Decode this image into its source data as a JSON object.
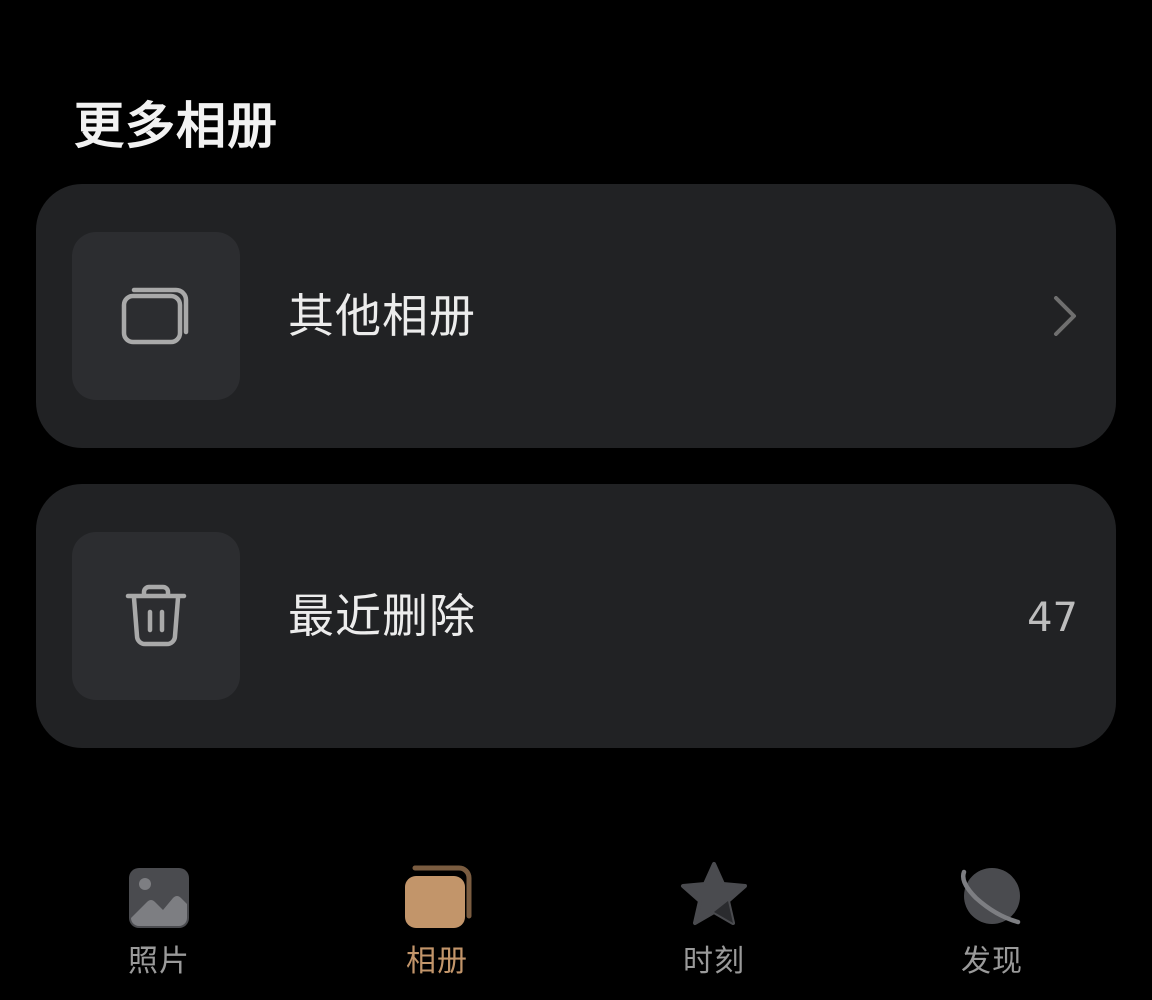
{
  "section": {
    "title": "更多相册"
  },
  "albums": [
    {
      "label": "其他相册",
      "icon": "albums-stack-icon",
      "trailing": "chevron-right-icon"
    },
    {
      "label": "最近删除",
      "icon": "trash-icon",
      "count": "47"
    }
  ],
  "tabbar": {
    "tabs": [
      {
        "label": "照片",
        "icon": "photo-icon",
        "active": false
      },
      {
        "label": "相册",
        "icon": "album-icon",
        "active": true
      },
      {
        "label": "时刻",
        "icon": "star-icon",
        "active": false
      },
      {
        "label": "发现",
        "icon": "planet-icon",
        "active": false
      }
    ]
  },
  "colors": {
    "background": "#000000",
    "card": "#212224",
    "thumb": "#2c2d30",
    "accent": "#c2956a",
    "inactive": "#9a9a9a"
  }
}
